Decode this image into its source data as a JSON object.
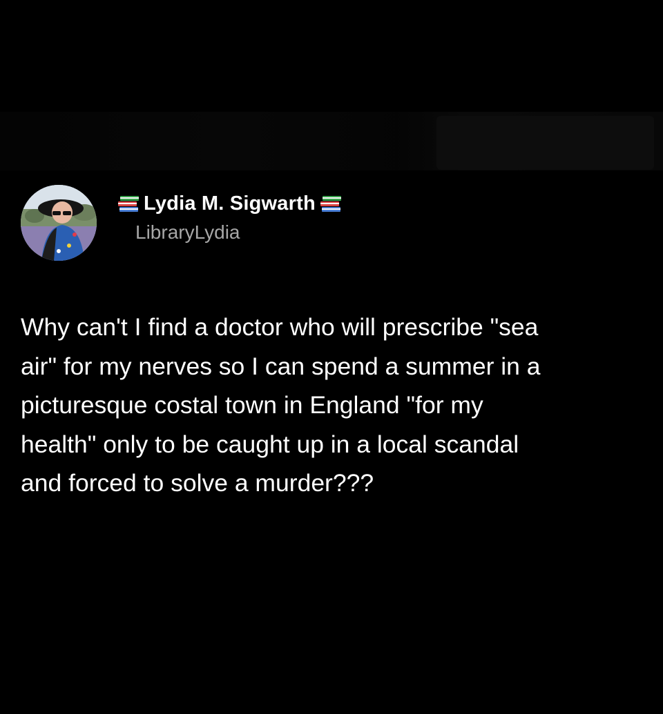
{
  "tweet": {
    "display_name": "Lydia M. Sigwarth",
    "handle": "LibraryLydia",
    "name_emoji_icon": "books-icon",
    "avatar_icon": "profile-avatar",
    "text": "Why can't I find a doctor who will prescribe \"sea\nair\" for my nerves so I can spend a summer in a\npicturesque costal town in England \"for my\nhealth\" only to be caught up in a local scandal\nand forced to solve a murder???"
  },
  "colors": {
    "background": "#000000",
    "text_primary": "#ffffff",
    "text_secondary": "#a7a7a7"
  }
}
